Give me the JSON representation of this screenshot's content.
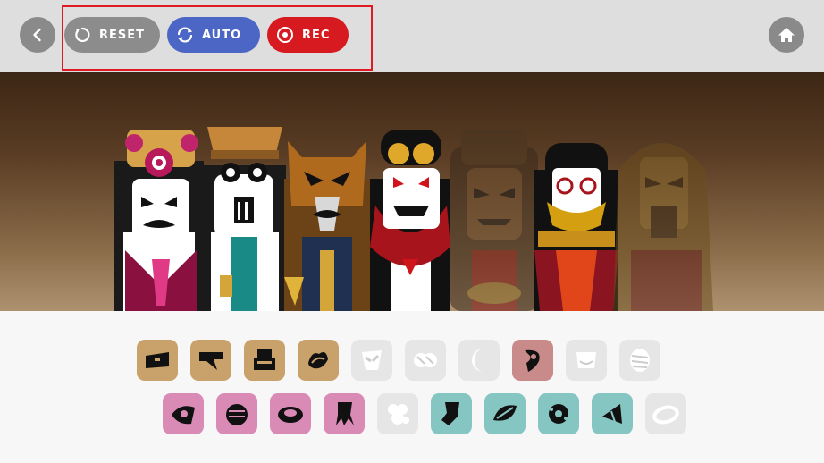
{
  "topbar": {
    "back_icon": "chevron-left-icon",
    "home_icon": "home-icon",
    "buttons": [
      {
        "label": "RESET",
        "icon": "reset-icon",
        "color": "#8c8c8c"
      },
      {
        "label": "AUTO",
        "icon": "sync-icon",
        "color": "#4b66c4"
      },
      {
        "label": "REC",
        "icon": "record-icon",
        "color": "#d71920"
      }
    ],
    "highlight_color": "#e01a22"
  },
  "stage": {
    "characters": [
      {
        "name": "character-1",
        "state": "active"
      },
      {
        "name": "character-2",
        "state": "active"
      },
      {
        "name": "character-3",
        "state": "active"
      },
      {
        "name": "character-4",
        "state": "active"
      },
      {
        "name": "character-5",
        "state": "dimmed"
      },
      {
        "name": "character-6",
        "state": "active"
      },
      {
        "name": "character-7",
        "state": "dimmed"
      }
    ]
  },
  "palette": {
    "row1": [
      {
        "icon": "hat-beat-icon",
        "category": "beat",
        "state": "available"
      },
      {
        "icon": "cap-beat-icon",
        "category": "beat",
        "state": "available"
      },
      {
        "icon": "helmet-beat-icon",
        "category": "beat",
        "state": "available"
      },
      {
        "icon": "wave-beat-icon",
        "category": "beat",
        "state": "available"
      },
      {
        "icon": "mask-effect-icon",
        "category": "effect",
        "state": "used"
      },
      {
        "icon": "goggles-effect-icon",
        "category": "effect",
        "state": "used"
      },
      {
        "icon": "moon-effect-icon",
        "category": "effect",
        "state": "used"
      },
      {
        "icon": "swirl-effect-icon",
        "category": "effect",
        "state": "available"
      },
      {
        "icon": "smile-effect-icon",
        "category": "effect",
        "state": "used"
      },
      {
        "icon": "wrap-effect-icon",
        "category": "effect",
        "state": "used"
      }
    ],
    "row2": [
      {
        "icon": "eye-melody-icon",
        "category": "melody",
        "state": "available"
      },
      {
        "icon": "hive-melody-icon",
        "category": "melody",
        "state": "available"
      },
      {
        "icon": "saucer-melody-icon",
        "category": "melody",
        "state": "available"
      },
      {
        "icon": "squid-melody-icon",
        "category": "melody",
        "state": "available"
      },
      {
        "icon": "flower-melody-icon",
        "category": "melody",
        "state": "used"
      },
      {
        "icon": "sock-voice-icon",
        "category": "voice",
        "state": "available"
      },
      {
        "icon": "leaf-voice-icon",
        "category": "voice",
        "state": "available"
      },
      {
        "icon": "gear-voice-icon",
        "category": "voice",
        "state": "available"
      },
      {
        "icon": "cone-voice-icon",
        "category": "voice",
        "state": "available"
      },
      {
        "icon": "ring-voice-icon",
        "category": "voice",
        "state": "used"
      }
    ]
  }
}
